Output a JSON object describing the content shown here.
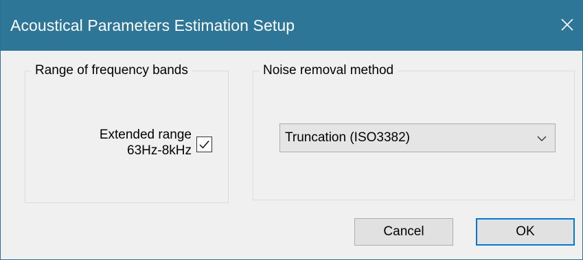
{
  "window": {
    "title": "Acoustical Parameters Estimation Setup",
    "close_icon": "close-icon",
    "titlebar_color": "#2e7697",
    "title_color": "#ffffff"
  },
  "frequency_group": {
    "label": "Range of frequency bands",
    "checkbox": {
      "label_line1": "Extended range",
      "label_line2": "63Hz-8kHz",
      "checked": true
    }
  },
  "noise_group": {
    "label": "Noise removal method",
    "dropdown": {
      "selected": "Truncation (ISO3382)",
      "arrow_icon": "chevron-down-icon"
    }
  },
  "buttons": {
    "cancel": "Cancel",
    "ok": "OK",
    "ok_focus_color": "#0078d7"
  }
}
